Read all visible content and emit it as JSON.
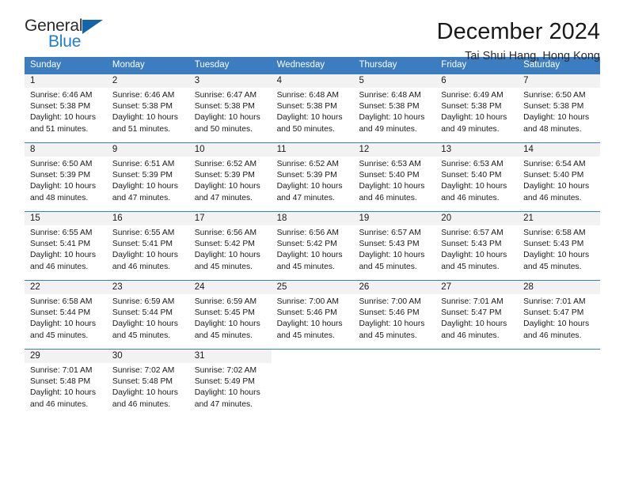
{
  "logo": {
    "word_top": "General",
    "word_bottom": "Blue",
    "triangle_color": "#1464aa",
    "blue_color": "#1d7fd1"
  },
  "header": {
    "title": "December 2024",
    "subtitle": "Tai Shui Hang, Hong Kong"
  },
  "theme": {
    "header_blue": "#3b7dc0",
    "band_gray": "#f2f2f2"
  },
  "weekdays": [
    "Sunday",
    "Monday",
    "Tuesday",
    "Wednesday",
    "Thursday",
    "Friday",
    "Saturday"
  ],
  "weeks": [
    [
      {
        "day": "1",
        "sunrise": "Sunrise: 6:46 AM",
        "sunset": "Sunset: 5:38 PM",
        "daylight_1": "Daylight: 10 hours",
        "daylight_2": "and 51 minutes."
      },
      {
        "day": "2",
        "sunrise": "Sunrise: 6:46 AM",
        "sunset": "Sunset: 5:38 PM",
        "daylight_1": "Daylight: 10 hours",
        "daylight_2": "and 51 minutes."
      },
      {
        "day": "3",
        "sunrise": "Sunrise: 6:47 AM",
        "sunset": "Sunset: 5:38 PM",
        "daylight_1": "Daylight: 10 hours",
        "daylight_2": "and 50 minutes."
      },
      {
        "day": "4",
        "sunrise": "Sunrise: 6:48 AM",
        "sunset": "Sunset: 5:38 PM",
        "daylight_1": "Daylight: 10 hours",
        "daylight_2": "and 50 minutes."
      },
      {
        "day": "5",
        "sunrise": "Sunrise: 6:48 AM",
        "sunset": "Sunset: 5:38 PM",
        "daylight_1": "Daylight: 10 hours",
        "daylight_2": "and 49 minutes."
      },
      {
        "day": "6",
        "sunrise": "Sunrise: 6:49 AM",
        "sunset": "Sunset: 5:38 PM",
        "daylight_1": "Daylight: 10 hours",
        "daylight_2": "and 49 minutes."
      },
      {
        "day": "7",
        "sunrise": "Sunrise: 6:50 AM",
        "sunset": "Sunset: 5:38 PM",
        "daylight_1": "Daylight: 10 hours",
        "daylight_2": "and 48 minutes."
      }
    ],
    [
      {
        "day": "8",
        "sunrise": "Sunrise: 6:50 AM",
        "sunset": "Sunset: 5:39 PM",
        "daylight_1": "Daylight: 10 hours",
        "daylight_2": "and 48 minutes."
      },
      {
        "day": "9",
        "sunrise": "Sunrise: 6:51 AM",
        "sunset": "Sunset: 5:39 PM",
        "daylight_1": "Daylight: 10 hours",
        "daylight_2": "and 47 minutes."
      },
      {
        "day": "10",
        "sunrise": "Sunrise: 6:52 AM",
        "sunset": "Sunset: 5:39 PM",
        "daylight_1": "Daylight: 10 hours",
        "daylight_2": "and 47 minutes."
      },
      {
        "day": "11",
        "sunrise": "Sunrise: 6:52 AM",
        "sunset": "Sunset: 5:39 PM",
        "daylight_1": "Daylight: 10 hours",
        "daylight_2": "and 47 minutes."
      },
      {
        "day": "12",
        "sunrise": "Sunrise: 6:53 AM",
        "sunset": "Sunset: 5:40 PM",
        "daylight_1": "Daylight: 10 hours",
        "daylight_2": "and 46 minutes."
      },
      {
        "day": "13",
        "sunrise": "Sunrise: 6:53 AM",
        "sunset": "Sunset: 5:40 PM",
        "daylight_1": "Daylight: 10 hours",
        "daylight_2": "and 46 minutes."
      },
      {
        "day": "14",
        "sunrise": "Sunrise: 6:54 AM",
        "sunset": "Sunset: 5:40 PM",
        "daylight_1": "Daylight: 10 hours",
        "daylight_2": "and 46 minutes."
      }
    ],
    [
      {
        "day": "15",
        "sunrise": "Sunrise: 6:55 AM",
        "sunset": "Sunset: 5:41 PM",
        "daylight_1": "Daylight: 10 hours",
        "daylight_2": "and 46 minutes."
      },
      {
        "day": "16",
        "sunrise": "Sunrise: 6:55 AM",
        "sunset": "Sunset: 5:41 PM",
        "daylight_1": "Daylight: 10 hours",
        "daylight_2": "and 46 minutes."
      },
      {
        "day": "17",
        "sunrise": "Sunrise: 6:56 AM",
        "sunset": "Sunset: 5:42 PM",
        "daylight_1": "Daylight: 10 hours",
        "daylight_2": "and 45 minutes."
      },
      {
        "day": "18",
        "sunrise": "Sunrise: 6:56 AM",
        "sunset": "Sunset: 5:42 PM",
        "daylight_1": "Daylight: 10 hours",
        "daylight_2": "and 45 minutes."
      },
      {
        "day": "19",
        "sunrise": "Sunrise: 6:57 AM",
        "sunset": "Sunset: 5:43 PM",
        "daylight_1": "Daylight: 10 hours",
        "daylight_2": "and 45 minutes."
      },
      {
        "day": "20",
        "sunrise": "Sunrise: 6:57 AM",
        "sunset": "Sunset: 5:43 PM",
        "daylight_1": "Daylight: 10 hours",
        "daylight_2": "and 45 minutes."
      },
      {
        "day": "21",
        "sunrise": "Sunrise: 6:58 AM",
        "sunset": "Sunset: 5:43 PM",
        "daylight_1": "Daylight: 10 hours",
        "daylight_2": "and 45 minutes."
      }
    ],
    [
      {
        "day": "22",
        "sunrise": "Sunrise: 6:58 AM",
        "sunset": "Sunset: 5:44 PM",
        "daylight_1": "Daylight: 10 hours",
        "daylight_2": "and 45 minutes."
      },
      {
        "day": "23",
        "sunrise": "Sunrise: 6:59 AM",
        "sunset": "Sunset: 5:44 PM",
        "daylight_1": "Daylight: 10 hours",
        "daylight_2": "and 45 minutes."
      },
      {
        "day": "24",
        "sunrise": "Sunrise: 6:59 AM",
        "sunset": "Sunset: 5:45 PM",
        "daylight_1": "Daylight: 10 hours",
        "daylight_2": "and 45 minutes."
      },
      {
        "day": "25",
        "sunrise": "Sunrise: 7:00 AM",
        "sunset": "Sunset: 5:46 PM",
        "daylight_1": "Daylight: 10 hours",
        "daylight_2": "and 45 minutes."
      },
      {
        "day": "26",
        "sunrise": "Sunrise: 7:00 AM",
        "sunset": "Sunset: 5:46 PM",
        "daylight_1": "Daylight: 10 hours",
        "daylight_2": "and 45 minutes."
      },
      {
        "day": "27",
        "sunrise": "Sunrise: 7:01 AM",
        "sunset": "Sunset: 5:47 PM",
        "daylight_1": "Daylight: 10 hours",
        "daylight_2": "and 46 minutes."
      },
      {
        "day": "28",
        "sunrise": "Sunrise: 7:01 AM",
        "sunset": "Sunset: 5:47 PM",
        "daylight_1": "Daylight: 10 hours",
        "daylight_2": "and 46 minutes."
      }
    ],
    [
      {
        "day": "29",
        "sunrise": "Sunrise: 7:01 AM",
        "sunset": "Sunset: 5:48 PM",
        "daylight_1": "Daylight: 10 hours",
        "daylight_2": "and 46 minutes."
      },
      {
        "day": "30",
        "sunrise": "Sunrise: 7:02 AM",
        "sunset": "Sunset: 5:48 PM",
        "daylight_1": "Daylight: 10 hours",
        "daylight_2": "and 46 minutes."
      },
      {
        "day": "31",
        "sunrise": "Sunrise: 7:02 AM",
        "sunset": "Sunset: 5:49 PM",
        "daylight_1": "Daylight: 10 hours",
        "daylight_2": "and 47 minutes."
      },
      {
        "day": "",
        "sunrise": "",
        "sunset": "",
        "daylight_1": "",
        "daylight_2": ""
      },
      {
        "day": "",
        "sunrise": "",
        "sunset": "",
        "daylight_1": "",
        "daylight_2": ""
      },
      {
        "day": "",
        "sunrise": "",
        "sunset": "",
        "daylight_1": "",
        "daylight_2": ""
      },
      {
        "day": "",
        "sunrise": "",
        "sunset": "",
        "daylight_1": "",
        "daylight_2": ""
      }
    ]
  ]
}
